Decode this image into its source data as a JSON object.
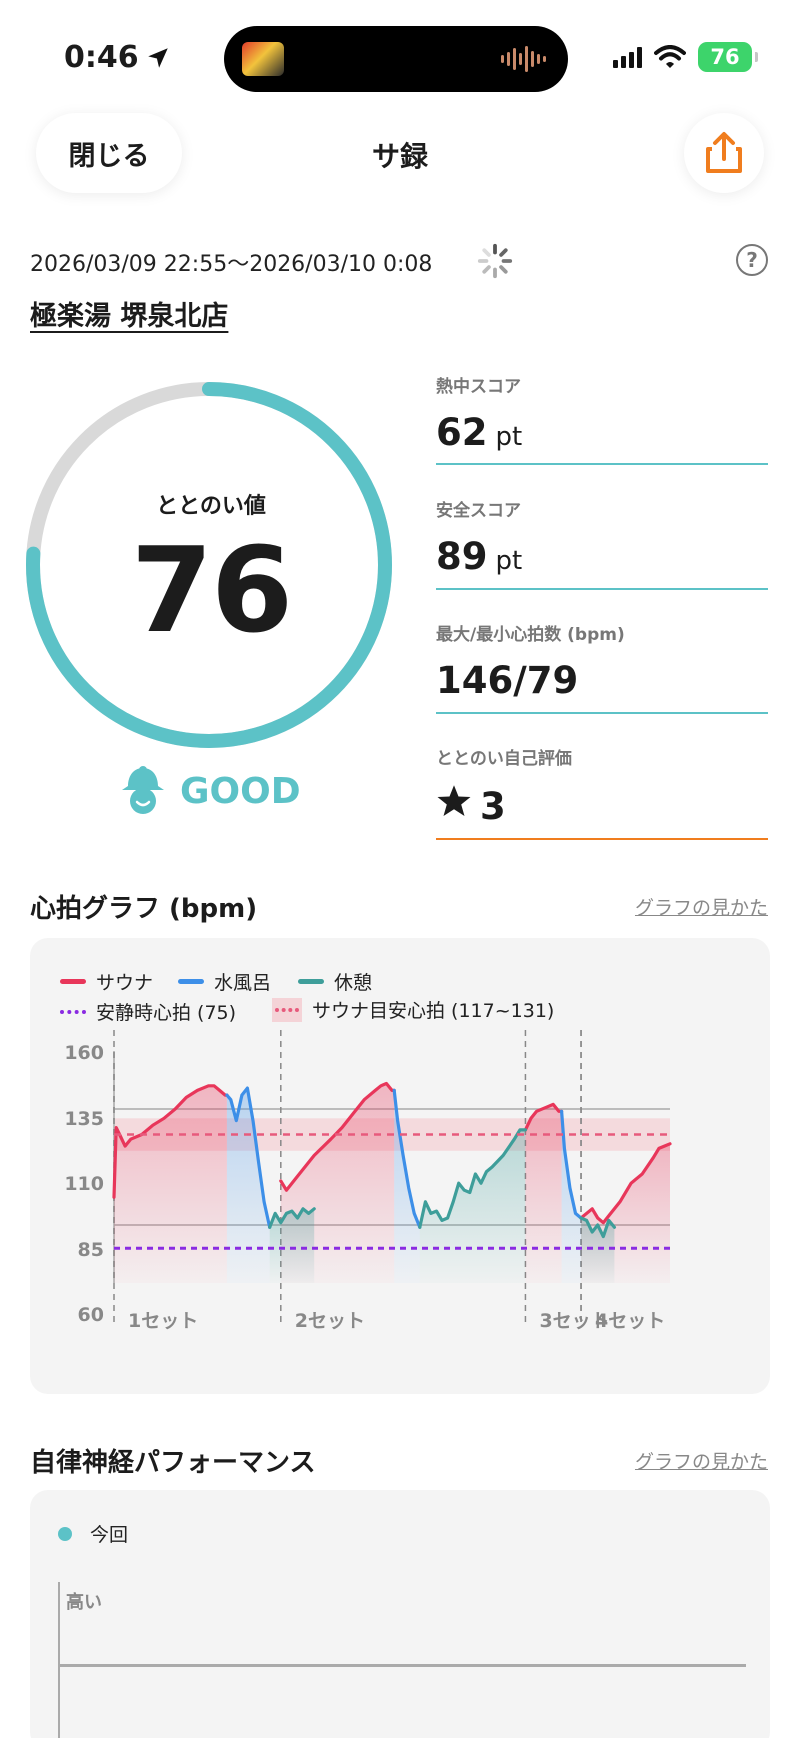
{
  "status_bar": {
    "time": "0:46",
    "battery": "76"
  },
  "nav": {
    "close_label": "閉じる",
    "title": "サ録"
  },
  "session": {
    "datetime": "2026/03/09 22:55～2026/03/10 0:08",
    "facility": "極楽湯 堺泉北店"
  },
  "gauge": {
    "label": "ととのい値",
    "value": "76",
    "fraction": 0.76,
    "status": "GOOD"
  },
  "metrics": [
    {
      "label": "熱中スコア",
      "value": "62",
      "unit": "pt"
    },
    {
      "label": "安全スコア",
      "value": "89",
      "unit": "pt"
    },
    {
      "label": "最大/最小心拍数 (bpm)",
      "value": "146/79",
      "unit": ""
    },
    {
      "label": "ととのい自己評価",
      "value": "3",
      "unit": ""
    }
  ],
  "colors": {
    "accent": "#5cc2c7",
    "sauna": "#e8365a",
    "cold_bath": "#3d8fe8",
    "rest": "#3e9e9a",
    "resting_hr": "#8a2be2",
    "target_zone": "#e75a7c",
    "share": "#f07d1e",
    "rating_line": "#f07d1e"
  },
  "hr_section": {
    "title": "心拍グラフ (bpm)",
    "link": "グラフの見かた"
  },
  "chart_data": {
    "type": "line",
    "title": "心拍グラフ (bpm)",
    "ylim": [
      60,
      160
    ],
    "yticks": [
      "160",
      "135",
      "110",
      "85",
      "60"
    ],
    "legend": [
      {
        "name": "サウナ",
        "style": "line"
      },
      {
        "name": "水風呂",
        "style": "line"
      },
      {
        "name": "休憩",
        "style": "line"
      },
      {
        "name": "安静時心拍 (75)",
        "style": "dotted"
      },
      {
        "name": "サウナ目安心拍 (117~131)",
        "style": "dotted-band"
      }
    ],
    "resting_hr": 75,
    "target_zone": [
      117,
      131
    ],
    "x_extent": [
      0,
      100
    ],
    "sets": [
      {
        "label": "1セット",
        "start": 0,
        "end": 30
      },
      {
        "label": "2セット",
        "start": 30,
        "end": 74
      },
      {
        "label": "3セット",
        "start": 74,
        "end": 84
      },
      {
        "label": "4セット",
        "start": 84,
        "end": 100
      }
    ],
    "series": [
      {
        "name": "サウナ",
        "segments": [
          [
            [
              0,
              97
            ],
            [
              0.4,
              127
            ],
            [
              1,
              124
            ],
            [
              2,
              119
            ],
            [
              3,
              122
            ],
            [
              5,
              124
            ],
            [
              7,
              128
            ],
            [
              9,
              131
            ],
            [
              11,
              135
            ],
            [
              13,
              140
            ],
            [
              15,
              143
            ],
            [
              17,
              145
            ],
            [
              18,
              145
            ],
            [
              19,
              143
            ],
            [
              20,
              141
            ],
            [
              20.3,
              141
            ]
          ],
          [
            [
              30,
              104
            ],
            [
              31,
              100
            ],
            [
              33,
              106
            ],
            [
              36,
              115
            ],
            [
              39,
              122
            ],
            [
              41,
              127
            ],
            [
              43,
              133
            ],
            [
              45,
              139
            ],
            [
              47,
              143
            ],
            [
              48,
              145
            ],
            [
              49,
              146
            ],
            [
              50,
              143
            ],
            [
              50.4,
              143
            ]
          ],
          [
            [
              74,
              126
            ],
            [
              75,
              131
            ],
            [
              76,
              134
            ],
            [
              78,
              136
            ],
            [
              79,
              137
            ],
            [
              80,
              134
            ],
            [
              80.5,
              134
            ]
          ],
          [
            [
              84,
              88
            ],
            [
              86,
              92
            ],
            [
              87,
              88
            ],
            [
              88,
              86
            ],
            [
              89,
              89
            ],
            [
              91,
              95
            ],
            [
              93,
              103
            ],
            [
              95,
              107
            ],
            [
              97,
              114
            ],
            [
              98,
              118
            ],
            [
              99,
              119
            ],
            [
              100,
              120
            ]
          ]
        ]
      },
      {
        "name": "水風呂",
        "segments": [
          [
            [
              20.3,
              141
            ],
            [
              21,
              139
            ],
            [
              22,
              130
            ],
            [
              23,
              141
            ],
            [
              24,
              144
            ],
            [
              25,
              130
            ],
            [
              26,
              112
            ],
            [
              27,
              95
            ],
            [
              28,
              84
            ]
          ],
          [
            [
              50.4,
              143
            ],
            [
              51,
              130
            ],
            [
              52,
              115
            ],
            [
              53,
              101
            ],
            [
              54,
              90
            ],
            [
              55,
              84
            ]
          ],
          [
            [
              80.5,
              134
            ],
            [
              81,
              118
            ],
            [
              82,
              101
            ],
            [
              83,
              90
            ],
            [
              84,
              88
            ]
          ]
        ]
      },
      {
        "name": "休憩",
        "segments": [
          [
            [
              28,
              84
            ],
            [
              29,
              90
            ],
            [
              30,
              86
            ],
            [
              31,
              90
            ],
            [
              32,
              91
            ],
            [
              33,
              88
            ],
            [
              34,
              92
            ],
            [
              35,
              90
            ],
            [
              36,
              92
            ]
          ],
          [
            [
              55,
              84
            ],
            [
              56,
              95
            ],
            [
              57,
              90
            ],
            [
              58,
              91
            ],
            [
              59,
              87
            ],
            [
              60,
              88
            ],
            [
              61,
              95
            ],
            [
              62,
              103
            ],
            [
              63,
              100
            ],
            [
              64,
              99
            ],
            [
              65,
              107
            ],
            [
              66,
              103
            ],
            [
              67,
              108
            ],
            [
              68,
              110
            ],
            [
              70,
              115
            ],
            [
              72,
              122
            ],
            [
              73,
              126
            ],
            [
              74,
              126
            ]
          ],
          [
            [
              84,
              88
            ],
            [
              85,
              87
            ],
            [
              86,
              82
            ],
            [
              87,
              85
            ],
            [
              88,
              80
            ],
            [
              89,
              87
            ],
            [
              90,
              84
            ]
          ]
        ]
      }
    ]
  },
  "ans_section": {
    "title": "自律神経パフォーマンス",
    "link": "グラフの見かた",
    "legend": "今回",
    "y_top": "高い"
  }
}
